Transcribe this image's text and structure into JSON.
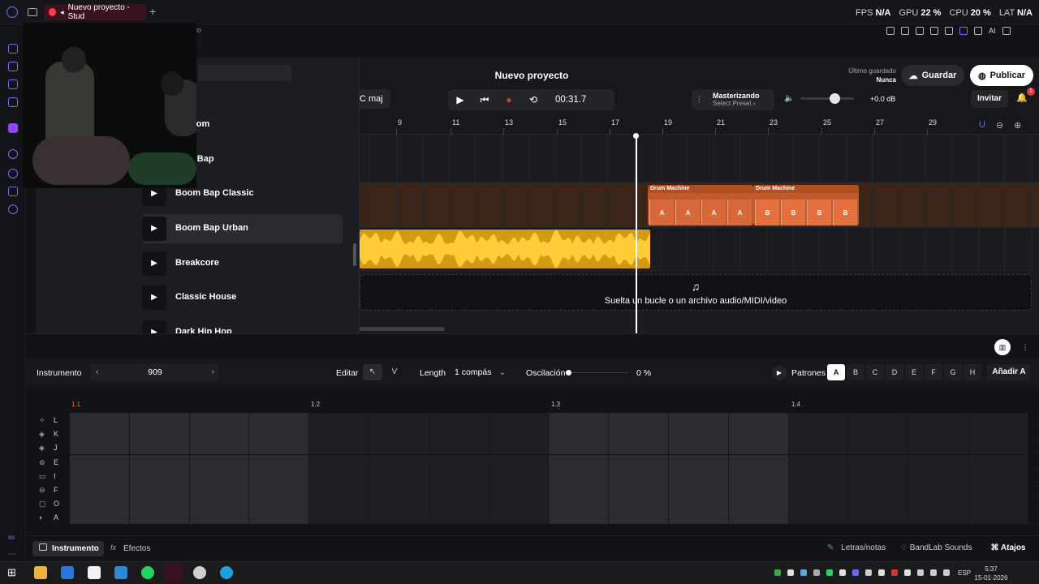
{
  "browser": {
    "tab_title": "Nuevo proyecto - Stud",
    "new_tab": "+",
    "perf": {
      "fps_label": "FPS",
      "fps_value": "N/A",
      "gpu_label": "GPU",
      "gpu_value": "22 %",
      "cpu_label": "CPU",
      "cpu_value": "20 %",
      "lat_label": "LAT",
      "lat_value": "N/A"
    },
    "partial_text": "dio"
  },
  "toolbar": {
    "ai_label": "AI"
  },
  "project": {
    "title": "Nuevo proyecto",
    "key": "C maj",
    "time": "00:31.7",
    "mastering_title": "Masterizando",
    "mastering_sub": "Select Preset ›",
    "volume_db": "+0.0 dB",
    "volume_level": 0.55,
    "last_saved_label": "Último guardado",
    "last_saved_value": "Nunca",
    "save_label": "Guardar",
    "publish_label": "Publicar",
    "invite_label": "Invitar",
    "notif_count": "1"
  },
  "ruler": {
    "ticks": [
      "9",
      "11",
      "13",
      "15",
      "17",
      "19",
      "21",
      "23",
      "25",
      "27",
      "29"
    ]
  },
  "tracks": {
    "drum_clips": [
      {
        "name": "Drum Machine",
        "steps": [
          "A",
          "A",
          "A",
          "A"
        ]
      },
      {
        "name": "Drum Machine",
        "steps": [
          "B",
          "B",
          "B",
          "B"
        ]
      }
    ],
    "drop_text": "Suelta un bucle o un archivo audio/MIDI/video"
  },
  "loops": {
    "items": [
      {
        "name": "oom",
        "active": false
      },
      {
        "name": "n Bap",
        "active": false
      },
      {
        "name": "Boom Bap Classic",
        "active": false
      },
      {
        "name": "Boom Bap Urban",
        "active": true
      },
      {
        "name": "Breakcore",
        "active": false
      },
      {
        "name": "Classic House",
        "active": false
      },
      {
        "name": "Dark Hip Hop",
        "active": false
      }
    ]
  },
  "editor": {
    "instrument_label": "Instrumento",
    "instrument_value": "909",
    "edit_label": "Editar",
    "length_label": "Length",
    "length_value": "1 compás",
    "swing_label": "Oscilación",
    "swing_value": "0 %",
    "patterns_label": "Patrones",
    "patterns": [
      "A",
      "B",
      "C",
      "D",
      "E",
      "F",
      "G",
      "H"
    ],
    "selected_pattern": "A",
    "add_pattern_label": "Añadir A",
    "seq_ticks": [
      "1.1",
      "1.2",
      "1.3",
      "1.4"
    ],
    "rows": [
      "L",
      "K",
      "J",
      "E",
      "I",
      "F",
      "O",
      "A"
    ]
  },
  "bottom": {
    "tab_instrument": "Instrumento",
    "tab_effects": "Efectos",
    "lyrics": "Letras/notas",
    "bandlab_sounds": "BandLab Sounds",
    "shortcuts": "Atajos"
  },
  "taskbar": {
    "time": "5:37",
    "date": "15-01-2026",
    "lang": "ESP"
  },
  "colors": {
    "accent": "#7b6cff",
    "drum_clip": "#c15a2c",
    "audio_clip": "#d39a14",
    "record": "#d33a3a"
  }
}
